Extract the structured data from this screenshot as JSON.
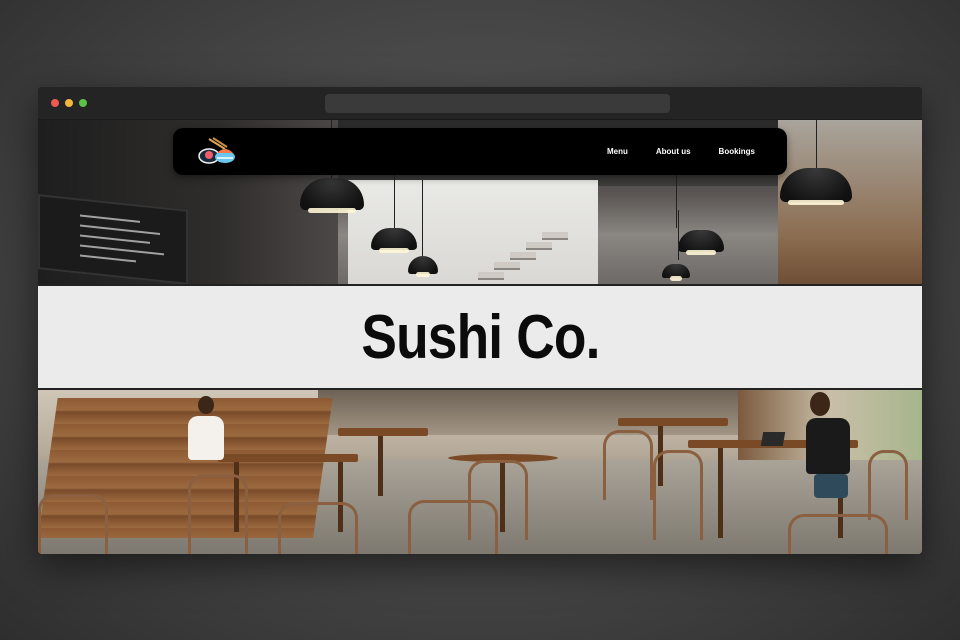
{
  "window": {
    "controls": [
      "close",
      "minimize",
      "maximize"
    ]
  },
  "nav": {
    "logo_icon": "sushi-logo-icon",
    "links": [
      {
        "label": "Menu"
      },
      {
        "label": "About us"
      },
      {
        "label": "Bookings"
      }
    ]
  },
  "hero": {
    "title": "Sushi Co.",
    "top_image": "restaurant-ceiling-photo",
    "bottom_image": "restaurant-dining-room-photo"
  },
  "colors": {
    "navbar_bg": "#000000",
    "band_bg": "#ebebeb",
    "title_color": "#0b0b0b",
    "window_chrome": "#242424",
    "close_dot": "#ee5a4f",
    "minimize_dot": "#f1b83a",
    "maximize_dot": "#5cc347"
  }
}
